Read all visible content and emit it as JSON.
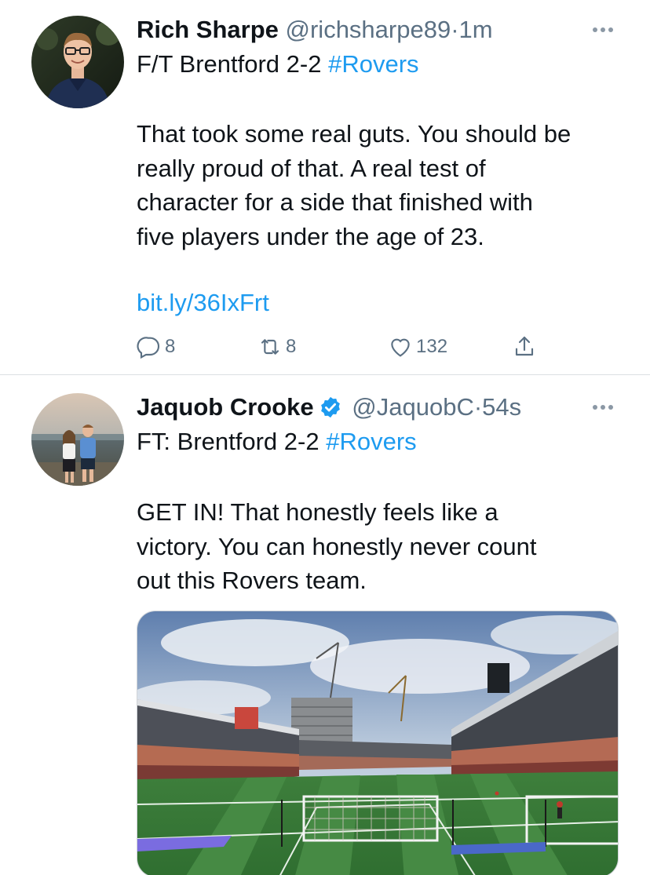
{
  "tweets": [
    {
      "author": "Rich Sharpe",
      "handle": "@richsharpe89",
      "separator": "·",
      "time": "1m",
      "headline_prefix": "F/T Brentford 2-2 ",
      "hashtag": "#Rovers",
      "text_lines": [
        "That took some real guts. You should be",
        "really proud of that. A real test of",
        "character for a side that finished with",
        "five players under the age of 23."
      ],
      "link": "bit.ly/36IxFrt",
      "replies": "8",
      "retweets": "8",
      "likes": "132"
    },
    {
      "author": "Jaquob Crooke",
      "verified": true,
      "handle": "@JaquobC",
      "separator": "·",
      "time": "54s",
      "headline_prefix": "FT: Brentford 2-2 ",
      "hashtag": "#Rovers",
      "text_lines": [
        "GET IN! That honestly feels like a",
        "victory. You can honestly never count",
        "out this Rovers team."
      ],
      "media": "stadium-photo"
    }
  ],
  "colors": {
    "link": "#1d9bf0",
    "muted": "#5b7083",
    "text": "#0f1419",
    "divider": "#dcdfe3"
  }
}
